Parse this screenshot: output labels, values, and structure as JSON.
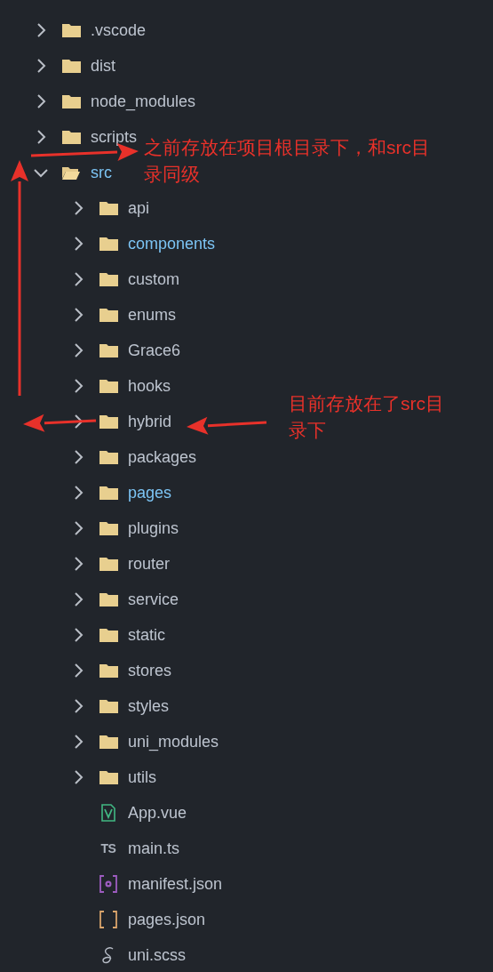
{
  "tree": [
    {
      "name": ".vscode",
      "kind": "folder",
      "expanded": false,
      "modified": false
    },
    {
      "name": "dist",
      "kind": "folder",
      "expanded": false,
      "modified": false
    },
    {
      "name": "node_modules",
      "kind": "folder",
      "expanded": false,
      "modified": false
    },
    {
      "name": "scripts",
      "kind": "folder",
      "expanded": false,
      "modified": false
    },
    {
      "name": "src",
      "kind": "folder",
      "expanded": true,
      "modified": true,
      "children": [
        {
          "name": "api",
          "kind": "folder",
          "expanded": false,
          "modified": false
        },
        {
          "name": "components",
          "kind": "folder",
          "expanded": false,
          "modified": true
        },
        {
          "name": "custom",
          "kind": "folder",
          "expanded": false,
          "modified": false
        },
        {
          "name": "enums",
          "kind": "folder",
          "expanded": false,
          "modified": false
        },
        {
          "name": "Grace6",
          "kind": "folder",
          "expanded": false,
          "modified": false
        },
        {
          "name": "hooks",
          "kind": "folder",
          "expanded": false,
          "modified": false
        },
        {
          "name": "hybrid",
          "kind": "folder",
          "expanded": false,
          "modified": false
        },
        {
          "name": "packages",
          "kind": "folder",
          "expanded": false,
          "modified": false
        },
        {
          "name": "pages",
          "kind": "folder",
          "expanded": false,
          "modified": true
        },
        {
          "name": "plugins",
          "kind": "folder",
          "expanded": false,
          "modified": false
        },
        {
          "name": "router",
          "kind": "folder",
          "expanded": false,
          "modified": false
        },
        {
          "name": "service",
          "kind": "folder",
          "expanded": false,
          "modified": false
        },
        {
          "name": "static",
          "kind": "folder",
          "expanded": false,
          "modified": false
        },
        {
          "name": "stores",
          "kind": "folder",
          "expanded": false,
          "modified": false
        },
        {
          "name": "styles",
          "kind": "folder",
          "expanded": false,
          "modified": false
        },
        {
          "name": "uni_modules",
          "kind": "folder",
          "expanded": false,
          "modified": false
        },
        {
          "name": "utils",
          "kind": "folder",
          "expanded": false,
          "modified": false
        },
        {
          "name": "App.vue",
          "kind": "vue",
          "modified": false
        },
        {
          "name": "main.ts",
          "kind": "ts",
          "badge": "TS",
          "modified": false
        },
        {
          "name": "manifest.json",
          "kind": "manifest",
          "modified": false
        },
        {
          "name": "pages.json",
          "kind": "json",
          "modified": false
        },
        {
          "name": "uni.scss",
          "kind": "scss",
          "modified": false
        }
      ]
    }
  ],
  "annotations": [
    {
      "lines": [
        "之前存放在项目根目录下，和src目",
        "录同级"
      ]
    },
    {
      "lines": [
        "目前存放在了src目",
        "录下"
      ]
    }
  ]
}
